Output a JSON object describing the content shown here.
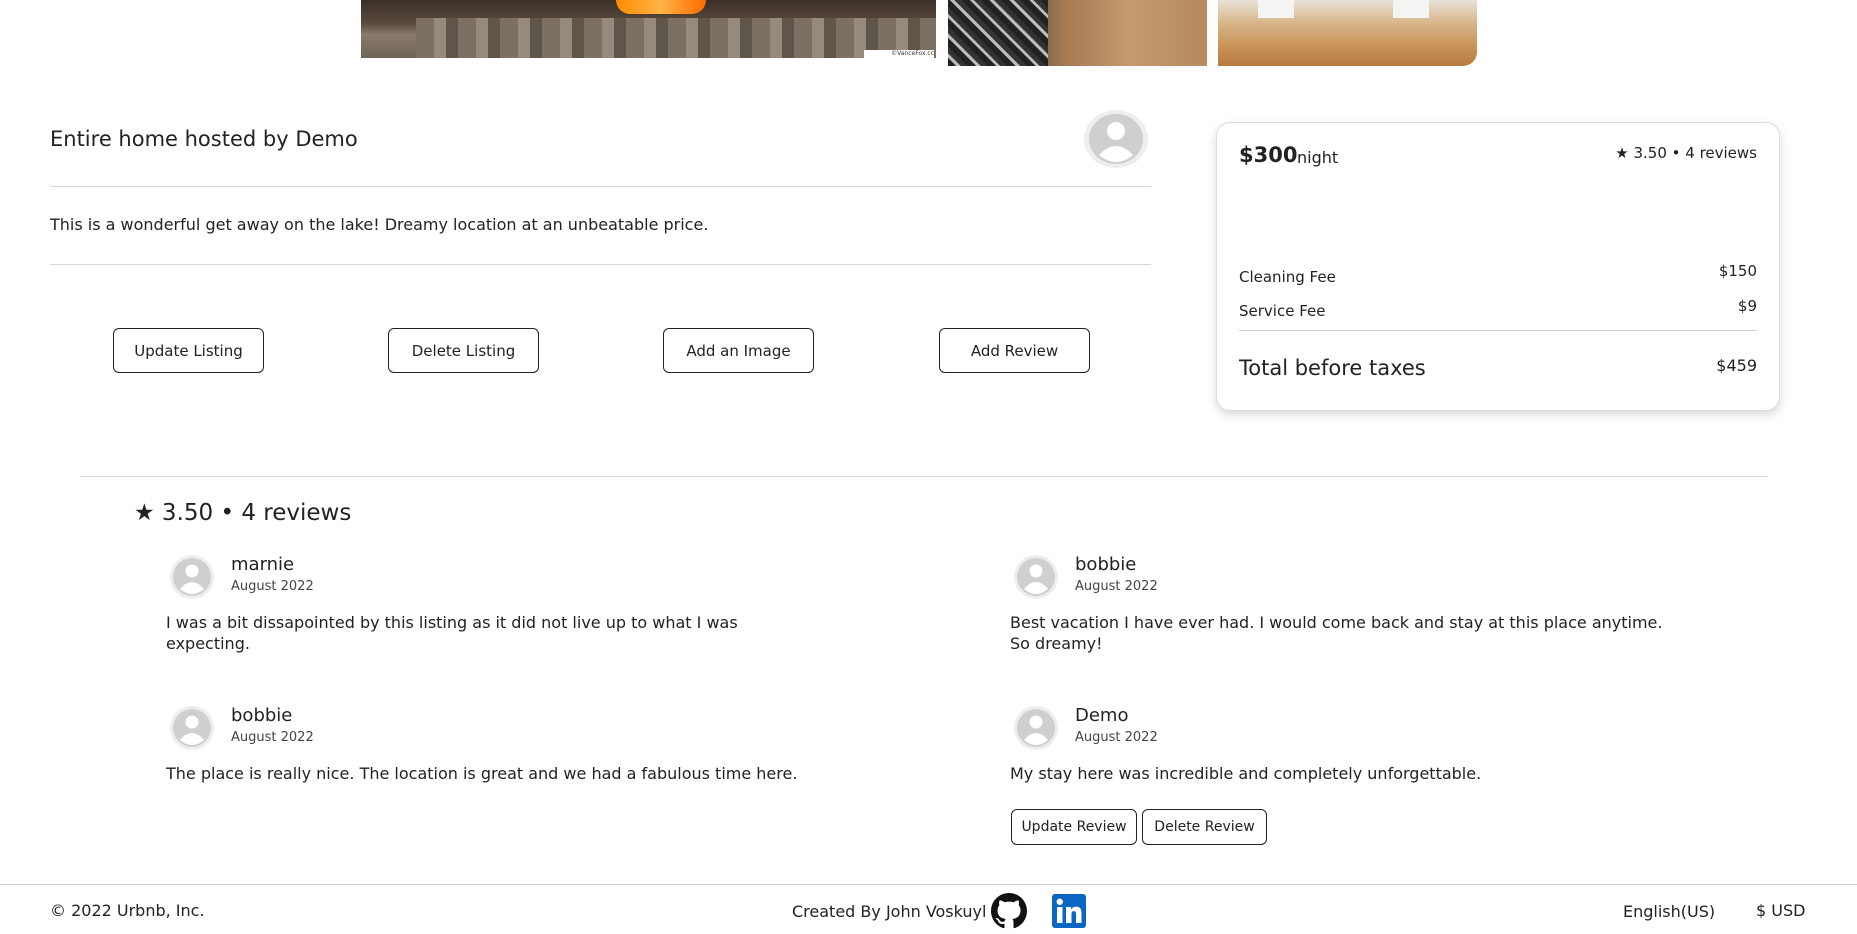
{
  "gallery": {
    "photo_credit": "©VanceFox.cc"
  },
  "listing": {
    "host_title": "Entire home hosted by Demo",
    "description": "This is a wonderful get away on the lake! Dreamy location at an unbeatable price.",
    "host_avatar_icon": "user-avatar-icon"
  },
  "actions": {
    "update_listing": "Update Listing",
    "delete_listing": "Delete Listing",
    "add_image": "Add an Image",
    "add_review": "Add Review"
  },
  "price_card": {
    "price": "$300",
    "unit": "night",
    "rating_summary": "★ 3.50 • 4 reviews",
    "fees": [
      {
        "label": "Cleaning Fee",
        "value": "$150"
      },
      {
        "label": "Service Fee",
        "value": "$9"
      }
    ],
    "total_label": "Total before taxes",
    "total_value": "$459"
  },
  "reviews": {
    "heading": "★ 3.50 • 4 reviews",
    "items": [
      {
        "author": "marnie",
        "date": "August 2022",
        "text": "I was a bit dissapointed by this listing as it did not live up to what I was expecting."
      },
      {
        "author": "bobbie",
        "date": "August 2022",
        "text": "Best vacation I have ever had. I would come back and stay at this place anytime. So dreamy!"
      },
      {
        "author": "bobbie",
        "date": "August 2022",
        "text": "The place is really nice. The location is great and we had a fabulous time here."
      },
      {
        "author": "Demo",
        "date": "August 2022",
        "text": "My stay here was incredible and completely unforgettable."
      }
    ],
    "update_review": "Update Review",
    "delete_review": "Delete Review"
  },
  "footer": {
    "copyright": "© 2022 Urbnb, Inc.",
    "credit": "Created By John Voskuyl",
    "github_icon": "github-icon",
    "linkedin_icon": "linkedin-icon",
    "language": "English(US)",
    "currency": "$ USD"
  },
  "colors": {
    "text": "#222222",
    "border": "#222222",
    "divider": "#d8d8d8",
    "avatar_bg": "#cfcfcf",
    "linkedin_blue": "#0a66c2"
  }
}
